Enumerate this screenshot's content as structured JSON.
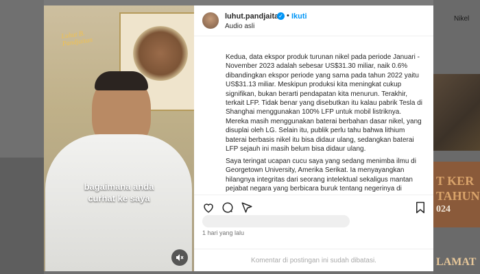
{
  "background": {
    "right_label": "Nikel",
    "promo_lines": [
      "T KER",
      "TAHUN",
      "024"
    ],
    "bottom_text": "LAMAT"
  },
  "media": {
    "watermark_line1": "Luhut B.",
    "watermark_line2": "Pandjaitan",
    "caption_line1": "bagaimana anda",
    "caption_line2": "curhat ke saya"
  },
  "header": {
    "username": "luhut.pandjaitan",
    "separator": "•",
    "follow_label": "Ikuti",
    "audio_label": "Audio asli"
  },
  "post": {
    "paragraph1": "Kedua, data ekspor produk turunan nikel pada periode Januari - November 2023 adalah sebesar US$31.30 miliar, naik 0.6% dibandingkan ekspor periode yang sama pada tahun 2022 yaitu US$31.13 miliar. Meskipun produksi kita meningkat cukup signifikan, bukan berarti pendapatan kita menurun. Terakhir, terkait LFP. Tidak benar yang disebutkan itu kalau pabrik Tesla di Shanghai menggunakan 100% LFP untuk mobil listriknya. Mereka masih menggunakan baterai berbahan dasar nikel, yang disuplai oleh LG. Selain itu, publik perlu tahu bahwa lithium baterai berbasis nikel itu bisa didaur ulang, sedangkan baterai LFP sejauh ini masih belum bisa didaur ulang.",
    "paragraph2": "Saya teringat ucapan cucu saya yang sedang menimba ilmu di Georgetown University, Amerika Serikat. Ia menyayangkan hilangnya integritas dari seorang intelektual sekaligus mantan pejabat negara yang berbicara buruk tentang negerinya di"
  },
  "meta": {
    "time_ago": "1 hari yang lalu",
    "comments_disabled": "Komentar di postingan ini sudah dibatasi."
  },
  "icons": [
    "like-icon",
    "comment-icon",
    "share-icon",
    "save-icon",
    "mute-icon",
    "verified-icon"
  ],
  "colors": {
    "accent": "#0095f6",
    "text": "#262626",
    "muted": "#737373"
  }
}
